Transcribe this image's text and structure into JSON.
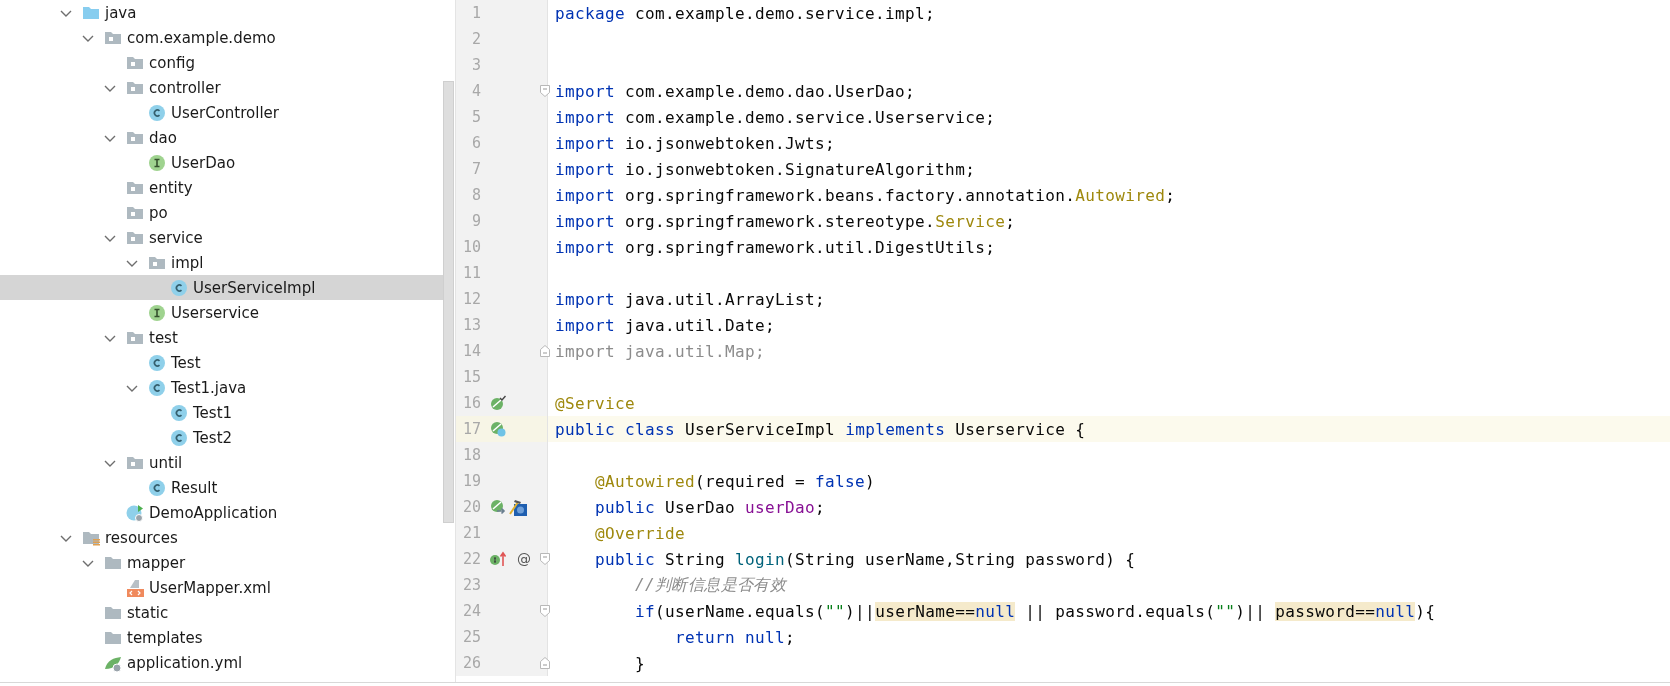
{
  "project_tree": {
    "items": [
      {
        "label": "java",
        "kind": "source-root",
        "expanded": true,
        "selected": false,
        "children": [
          {
            "label": "com.example.demo",
            "kind": "package",
            "expanded": true,
            "selected": false,
            "children": [
              {
                "label": "config",
                "kind": "package",
                "selected": false
              },
              {
                "label": "controller",
                "kind": "package",
                "expanded": true,
                "selected": false,
                "children": [
                  {
                    "label": "UserController",
                    "kind": "class",
                    "selected": false
                  }
                ]
              },
              {
                "label": "dao",
                "kind": "package",
                "expanded": true,
                "selected": false,
                "children": [
                  {
                    "label": "UserDao",
                    "kind": "interface",
                    "selected": false
                  }
                ]
              },
              {
                "label": "entity",
                "kind": "package",
                "selected": false
              },
              {
                "label": "po",
                "kind": "package",
                "selected": false
              },
              {
                "label": "service",
                "kind": "package",
                "expanded": true,
                "selected": false,
                "children": [
                  {
                    "label": "impl",
                    "kind": "package",
                    "expanded": true,
                    "selected": false,
                    "children": [
                      {
                        "label": "UserServiceImpl",
                        "kind": "class",
                        "selected": true
                      }
                    ]
                  },
                  {
                    "label": "Userservice",
                    "kind": "interface",
                    "selected": false
                  }
                ]
              },
              {
                "label": "test",
                "kind": "package",
                "expanded": true,
                "selected": false,
                "children": [
                  {
                    "label": "Test",
                    "kind": "class",
                    "selected": false
                  },
                  {
                    "label": "Test1.java",
                    "kind": "class",
                    "expanded": true,
                    "selected": false,
                    "children": [
                      {
                        "label": "Test1",
                        "kind": "class",
                        "selected": false
                      },
                      {
                        "label": "Test2",
                        "kind": "class",
                        "selected": false
                      }
                    ]
                  }
                ]
              },
              {
                "label": "until",
                "kind": "package",
                "expanded": true,
                "selected": false,
                "children": [
                  {
                    "label": "Result",
                    "kind": "class",
                    "selected": false
                  }
                ]
              },
              {
                "label": "DemoApplication",
                "kind": "spring-app",
                "selected": false
              }
            ]
          }
        ]
      },
      {
        "label": "resources",
        "kind": "resources",
        "expanded": true,
        "selected": false,
        "children": [
          {
            "label": "mapper",
            "kind": "folder",
            "expanded": true,
            "selected": false,
            "children": [
              {
                "label": "UserMapper.xml",
                "kind": "xml",
                "selected": false
              }
            ]
          },
          {
            "label": "static",
            "kind": "folder",
            "selected": false
          },
          {
            "label": "templates",
            "kind": "folder",
            "selected": false
          },
          {
            "label": "application.yml",
            "kind": "yml",
            "selected": false
          }
        ]
      }
    ]
  },
  "editor": {
    "lines": [
      {
        "number": "1",
        "current": false,
        "tokens": [
          {
            "t": "package",
            "kind": "kw"
          },
          {
            "t": " com.example.demo.service.impl;",
            "kind": "plain"
          }
        ]
      },
      {
        "number": "2",
        "current": false
      },
      {
        "number": "3",
        "current": false
      },
      {
        "number": "4",
        "current": false,
        "fold": {
          "kind": "start"
        },
        "tokens": [
          {
            "t": "import",
            "kind": "kw"
          },
          {
            "t": " com.example.demo.dao.UserDao;",
            "kind": "plain"
          }
        ]
      },
      {
        "number": "5",
        "current": false,
        "tokens": [
          {
            "t": "import",
            "kind": "kw"
          },
          {
            "t": " com.example.demo.service.Userservice;",
            "kind": "plain"
          }
        ]
      },
      {
        "number": "6",
        "current": false,
        "tokens": [
          {
            "t": "import",
            "kind": "kw"
          },
          {
            "t": " io.jsonwebtoken.Jwts;",
            "kind": "plain"
          }
        ]
      },
      {
        "number": "7",
        "current": false,
        "tokens": [
          {
            "t": "import",
            "kind": "kw"
          },
          {
            "t": " io.jsonwebtoken.SignatureAlgorithm;",
            "kind": "plain"
          }
        ]
      },
      {
        "number": "8",
        "current": false,
        "tokens": [
          {
            "t": "import",
            "kind": "kw"
          },
          {
            "t": " org.springframework.beans.factory.annotation.",
            "kind": "plain"
          },
          {
            "t": "Autowired",
            "kind": "ann"
          },
          {
            "t": ";",
            "kind": "plain"
          }
        ]
      },
      {
        "number": "9",
        "current": false,
        "tokens": [
          {
            "t": "import",
            "kind": "kw"
          },
          {
            "t": " org.springframework.stereotype.",
            "kind": "plain"
          },
          {
            "t": "Service",
            "kind": "ann"
          },
          {
            "t": ";",
            "kind": "plain"
          }
        ]
      },
      {
        "number": "10",
        "current": false,
        "tokens": [
          {
            "t": "import",
            "kind": "kw"
          },
          {
            "t": " org.springframework.util.DigestUtils;",
            "kind": "plain"
          }
        ]
      },
      {
        "number": "11",
        "current": false
      },
      {
        "number": "12",
        "current": false,
        "tokens": [
          {
            "t": "import",
            "kind": "kw"
          },
          {
            "t": " java.util.ArrayList;",
            "kind": "plain"
          }
        ]
      },
      {
        "number": "13",
        "current": false,
        "tokens": [
          {
            "t": "import",
            "kind": "kw"
          },
          {
            "t": " java.util.Date;",
            "kind": "plain"
          }
        ]
      },
      {
        "number": "14",
        "current": false,
        "fold": {
          "kind": "end"
        },
        "tokens": [
          {
            "t": "import java.util.Map;",
            "kind": "unused"
          }
        ]
      },
      {
        "number": "15",
        "current": false
      },
      {
        "number": "16",
        "current": false,
        "gutter": [
          {
            "kind": "bean-check"
          }
        ],
        "tokens": [
          {
            "t": "@Service",
            "kind": "ann"
          }
        ]
      },
      {
        "number": "17",
        "current": true,
        "gutter": [
          {
            "kind": "bean-class"
          }
        ],
        "tokens": [
          {
            "t": "public",
            "kind": "kw"
          },
          {
            "t": " class",
            "kind": "kw"
          },
          {
            "t": " UserServiceImpl ",
            "kind": "plain"
          },
          {
            "t": "implements",
            "kind": "kw"
          },
          {
            "t": " Userservice {",
            "kind": "plain"
          }
        ]
      },
      {
        "number": "18",
        "current": false
      },
      {
        "number": "19",
        "current": false,
        "tokens": [
          {
            "t": "    @Autowired",
            "kind": "ann"
          },
          {
            "t": "(required = ",
            "kind": "plain"
          },
          {
            "t": "false",
            "kind": "kw"
          },
          {
            "t": ")",
            "kind": "plain"
          }
        ]
      },
      {
        "number": "20",
        "current": false,
        "gutter": [
          {
            "kind": "bean-arrow"
          },
          {
            "kind": "hammer"
          }
        ],
        "tokens": [
          {
            "t": "    public",
            "kind": "kw"
          },
          {
            "t": " UserDao ",
            "kind": "plain"
          },
          {
            "t": "userDao",
            "kind": "field"
          },
          {
            "t": ";",
            "kind": "plain"
          }
        ]
      },
      {
        "number": "21",
        "current": false,
        "tokens": [
          {
            "t": "    @Override",
            "kind": "ann"
          }
        ]
      },
      {
        "number": "22",
        "current": false,
        "fold": {
          "kind": "start"
        },
        "gutter": [
          {
            "kind": "implements-up"
          },
          {
            "kind": "at",
            "text": "@"
          }
        ],
        "tokens": [
          {
            "t": "    public",
            "kind": "kw"
          },
          {
            "t": " String ",
            "kind": "plain"
          },
          {
            "t": "login",
            "kind": "fn"
          },
          {
            "t": "(String userName,String password) {",
            "kind": "plain"
          }
        ]
      },
      {
        "number": "23",
        "current": false,
        "tokens": [
          {
            "t": "        //判断信息是否有效",
            "kind": "comment"
          }
        ]
      },
      {
        "number": "24",
        "current": false,
        "fold": {
          "kind": "start"
        },
        "tokens": [
          {
            "t": "        if",
            "kind": "kw"
          },
          {
            "t": "(userName.equals(",
            "kind": "plain"
          },
          {
            "t": "\"\"",
            "kind": "str"
          },
          {
            "t": ")||",
            "kind": "plain"
          },
          {
            "t": "userName==",
            "kind": "hl"
          },
          {
            "t": "null",
            "kind": "hlkw"
          },
          {
            "t": " || password.equals(",
            "kind": "plain"
          },
          {
            "t": "\"\"",
            "kind": "str"
          },
          {
            "t": ")|| ",
            "kind": "plain"
          },
          {
            "t": "password==",
            "kind": "hl"
          },
          {
            "t": "null",
            "kind": "hlkw"
          },
          {
            "t": "){",
            "kind": "plain"
          }
        ]
      },
      {
        "number": "25",
        "current": false,
        "tokens": [
          {
            "t": "            return",
            "kind": "kw"
          },
          {
            "t": " null",
            "kind": "kw"
          },
          {
            "t": ";",
            "kind": "plain"
          }
        ]
      },
      {
        "number": "26",
        "current": false,
        "fold": {
          "kind": "end"
        },
        "tokens": [
          {
            "t": "        }",
            "kind": "plain"
          }
        ]
      }
    ]
  }
}
